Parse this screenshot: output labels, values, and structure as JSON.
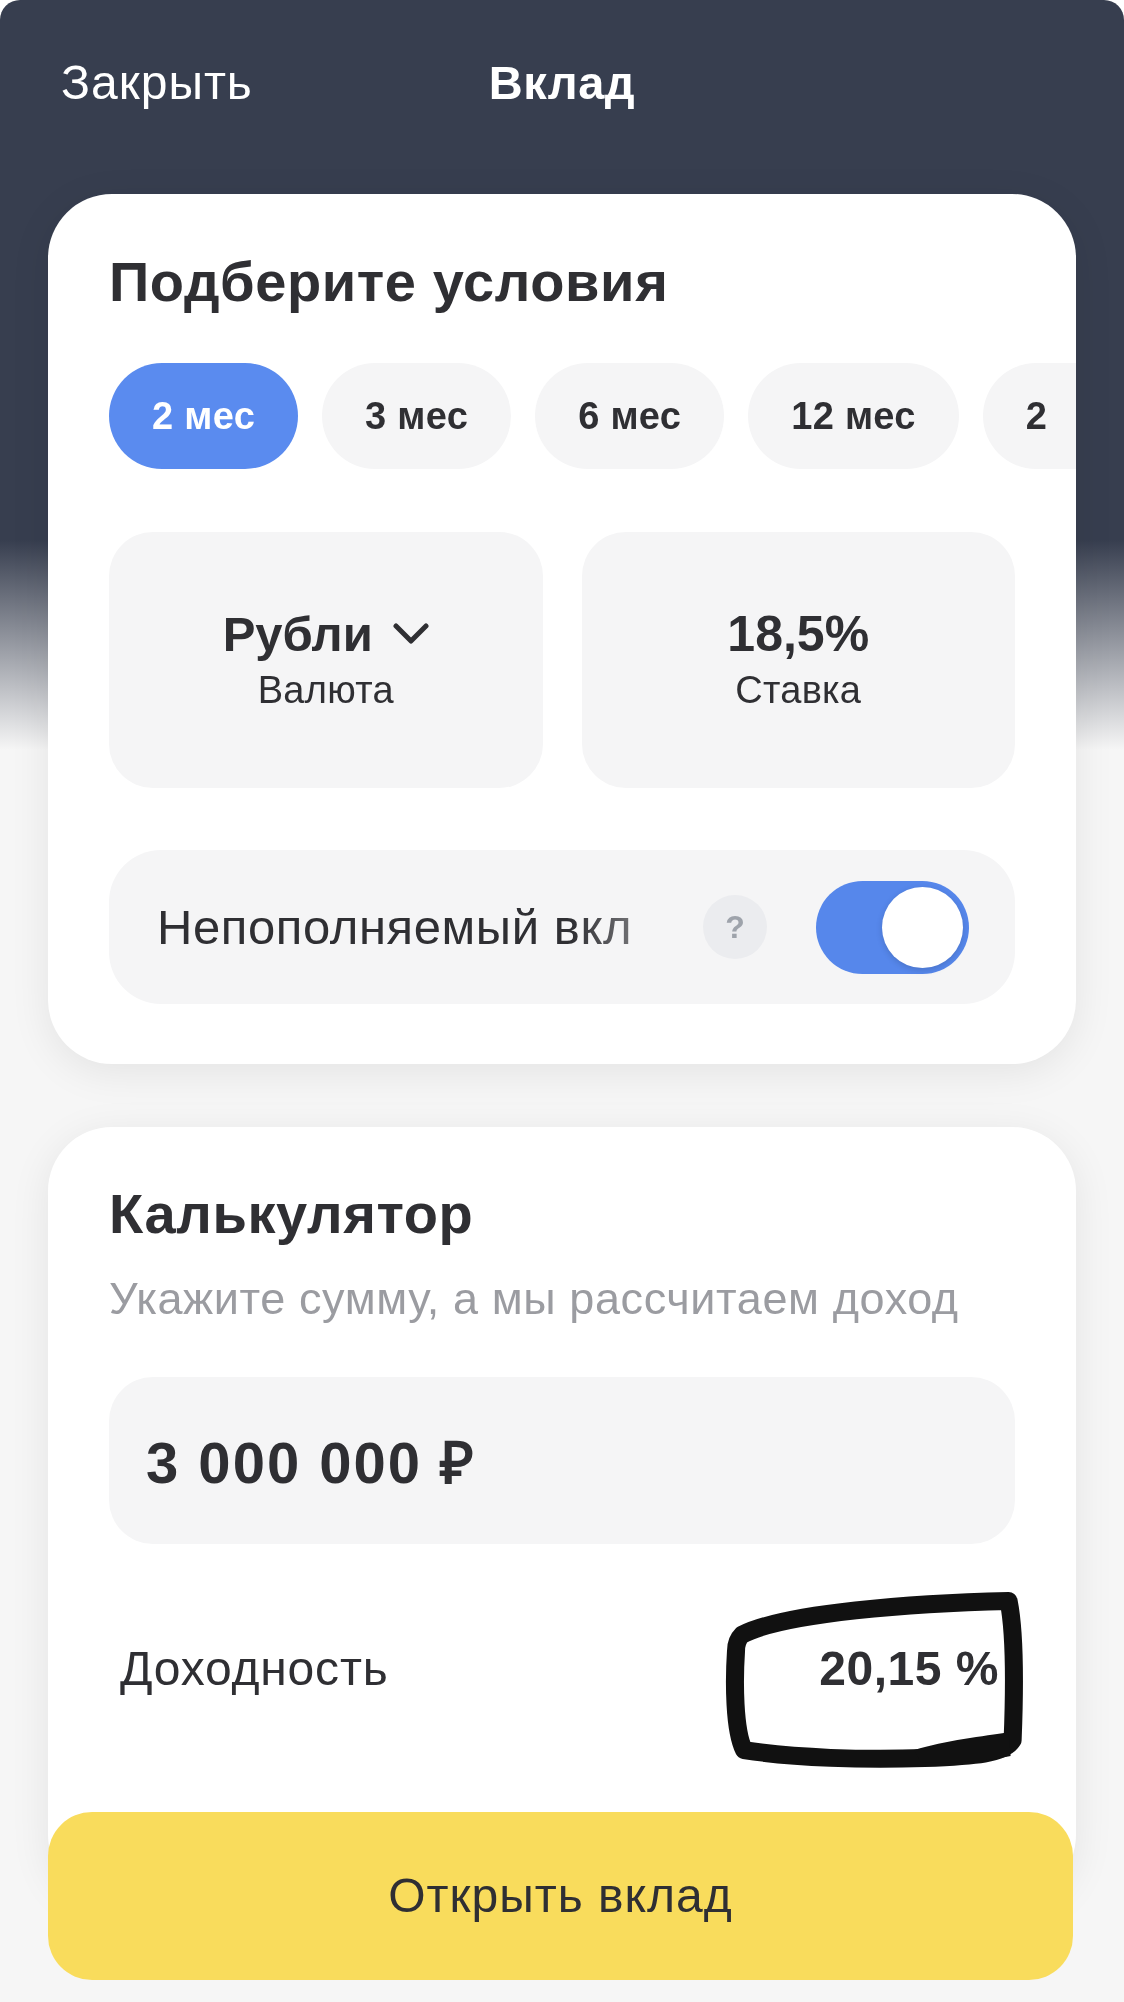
{
  "header": {
    "close": "Закрыть",
    "title": "Вклад"
  },
  "conditions": {
    "title": "Подберите условия",
    "terms": [
      {
        "label": "2 мес",
        "selected": true
      },
      {
        "label": "3 мес",
        "selected": false
      },
      {
        "label": "6 мес",
        "selected": false
      },
      {
        "label": "12 мес",
        "selected": false
      },
      {
        "label": "2",
        "selected": false
      }
    ],
    "tiles": [
      {
        "kind": "dropdown",
        "value": "Рубли",
        "caption": "Валюта"
      },
      {
        "kind": "static",
        "value": "18,5%",
        "caption": "Ставка"
      }
    ],
    "option": {
      "label": "Непополняемый вкл",
      "help": "?",
      "on": true
    }
  },
  "calculator": {
    "title": "Калькулятор",
    "subtitle": "Укажите сумму, а мы рассчитаем доход",
    "amount": {
      "value": "3 000 000 ₽"
    },
    "yield": {
      "label": "Доходность",
      "value": "20,15 %",
      "marked": true
    }
  },
  "open_button": "Открыть вклад"
}
